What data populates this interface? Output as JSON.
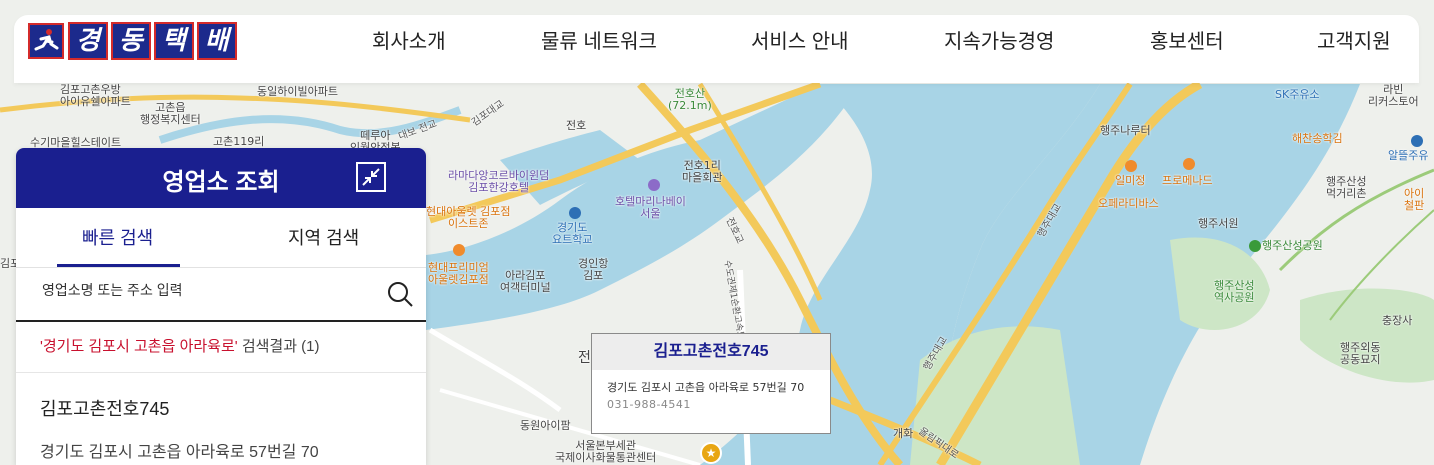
{
  "brand": {
    "name": "경동택배",
    "logo_chars": [
      "경",
      "동",
      "택",
      "배"
    ]
  },
  "nav": {
    "items": [
      "회사소개",
      "물류 네트워크",
      "서비스 안내",
      "지속가능경영",
      "홍보센터",
      "고객지원"
    ]
  },
  "panel": {
    "title": "영업소 조회",
    "tabs": [
      "빠른 검색",
      "지역 검색"
    ],
    "active_tab": "빠른 검색",
    "search_placeholder": "영업소명 또는 주소 입력",
    "result_query": "'경기도 김포시 고촌읍 아라육로'",
    "result_suffix": "검색결과 (1)",
    "results": [
      {
        "name": "김포고촌전호745",
        "address": "경기도 김포시 고촌읍 아라육로 57번길 70"
      }
    ]
  },
  "popup": {
    "title": "김포고촌전호745",
    "address": "경기도 김포시 고촌읍 아라육로 57번길 70",
    "phone": "031-988-4541"
  },
  "map_labels": {
    "l1": "김포고촌우방\n아이유쉘아파트",
    "l2": "동일하이빌아파트",
    "l3": "고촌읍\n행정복지센터",
    "l4": "수기마을힐스테이트",
    "l5": "고촌119리",
    "l6": "떼루아\n인월안정복",
    "l7": "전호산\n(72.1m)",
    "l8": "전호",
    "l9": "라마다앙코르바이윈덤\n김포한강호텔",
    "l10": "전호1리\n마을회관",
    "l11": "호텔마리나베이\n서울",
    "l12": "현대아울렛 김포점\n이스트존",
    "l13": "경기도\n요트학교",
    "l14": "현대프리미엄\n아울렛김포점",
    "l15": "아라김포\n여객터미널",
    "l16": "경인항\n김포",
    "l17": "동원아이팜",
    "l18": "서울본부세관\n국제이사화물통관센터",
    "l19": "개화",
    "l20": "행주나루터",
    "l21": "일미정",
    "l22": "프로메나드",
    "l23": "오페라디바스",
    "l24": "행주서원",
    "l25": "행주산성공원",
    "l26": "행주산성\n역사공원",
    "l27": "SK주유소",
    "l28": "라빈\n리커스토어",
    "l29": "해찬송학김",
    "l30": "알뜰주유",
    "l31": "행주산성\n먹거리촌",
    "l32": "아이\n철판",
    "l33": "충장사",
    "l34": "행주외동\n공동묘지",
    "l35": "행주대교",
    "l36": "행주대교",
    "l37": "올림픽대로",
    "l38": "전",
    "l39": "김포대교",
    "l40": "대보 전교",
    "l41": "수도권제1순환고속도로",
    "l42": "전호교",
    "l43": "김포"
  },
  "colors": {
    "brand_navy": "#1a1f8f",
    "accent_red": "#c8102e",
    "water": "#a8d4e6",
    "road_yellow": "#f3c95a",
    "park_green": "#cde6c6"
  }
}
